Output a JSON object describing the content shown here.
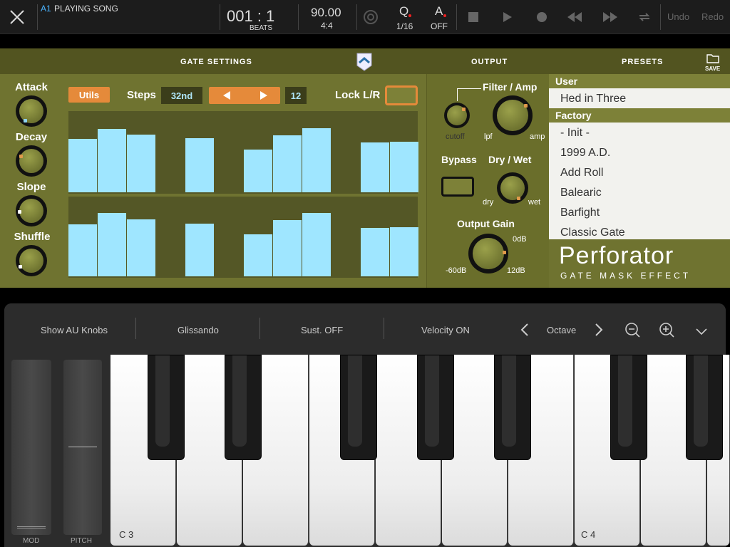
{
  "topbar": {
    "track": "A1",
    "status": "PLAYING SONG",
    "position": "001 : 1",
    "position_unit": "BEATS",
    "tempo": "90.00",
    "signature": "4:4",
    "quantize_label": "Q",
    "quantize_value": "1/16",
    "auto_label": "A",
    "auto_value": "OFF",
    "undo": "Undo",
    "redo": "Redo"
  },
  "header": {
    "gate_settings": "GATE SETTINGS",
    "output": "OUTPUT",
    "presets": "PRESETS",
    "save": "SAVE"
  },
  "left": {
    "knobs": [
      "Attack",
      "Decay",
      "Slope",
      "Shuffle"
    ],
    "utils": "Utils",
    "steps_label": "Steps",
    "steps_value": "32nd",
    "step_count": "12",
    "lock_label": "Lock L/R"
  },
  "sequencer": {
    "top_levels": [
      0.72,
      0.86,
      0.78,
      0,
      0.73,
      0,
      0.58,
      0.77,
      0.87,
      0,
      0.67,
      0.68
    ],
    "bottom_levels": [
      0.72,
      0.87,
      0.78,
      0,
      0.73,
      0,
      0.58,
      0.77,
      0.87,
      0,
      0.67,
      0.68
    ]
  },
  "mid": {
    "filter_amp": "Filter / Amp",
    "cutoff": "cutoff",
    "lpf": "lpf",
    "amp": "amp",
    "bypass": "Bypass",
    "dry_wet": "Dry / Wet",
    "dry": "dry",
    "wet": "wet",
    "output_gain": "Output Gain",
    "gain_min": "-60dB",
    "gain_mid": "0dB",
    "gain_max": "12dB"
  },
  "presets": {
    "user_head": "User",
    "user": [
      "Hed in Three"
    ],
    "factory_head": "Factory",
    "factory": [
      "- Init -",
      "1999 A.D.",
      "Add Roll",
      "Balearic",
      "Barfight",
      "Classic Gate"
    ]
  },
  "brand": {
    "name": "Perforator",
    "tagline": "GATE MASK EFFECT"
  },
  "keyboard": {
    "show_knobs": "Show AU Knobs",
    "glissando": "Glissando",
    "sustain": "Sust. OFF",
    "velocity": "Velocity ON",
    "octave": "Octave",
    "mod": "MOD",
    "pitch": "PITCH",
    "c3": "C 3",
    "c4": "C 4"
  },
  "colors": {
    "accent": "#e58a3a",
    "bars": "#9fe6ff",
    "plugin_bg": "#6f7330"
  }
}
